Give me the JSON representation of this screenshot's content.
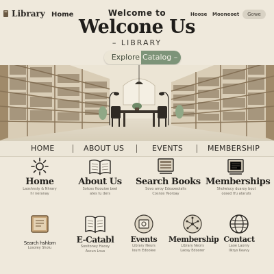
{
  "header": {
    "logo_text": "Library",
    "nav_home": "Home",
    "nav_right": [
      "Hoose",
      "Mooneoet"
    ],
    "nav_pill": "Gowe"
  },
  "hero": {
    "title_small": "Welcome to",
    "title_big": "Welcone Us",
    "title_sub": "– LIBRARY",
    "cta_left": "Explore",
    "cta_right": "Catalog –"
  },
  "nav": {
    "items": [
      "HOME",
      "ABOUT US",
      "EVENTS",
      "MEMBERSHIP"
    ]
  },
  "features_top": [
    {
      "title": "Home",
      "desc": [
        "Laoshnsty & Nhrary",
        "hr neranay"
      ],
      "icon": "sun-icon"
    },
    {
      "title": "About Us",
      "desc": [
        "Sotoss ftoouioe beel",
        "ates tu ders"
      ],
      "icon": "open-book-icon"
    },
    {
      "title": "Search Books",
      "desc": [
        "Sovo arroy Edoaxeolalis",
        "Cosnos Yeoroay"
      ],
      "icon": "book-stack-icon"
    },
    {
      "title": "Memberships",
      "desc": [
        "Sholwiucy duaroy bout",
        "oosed tfu ataruts"
      ],
      "icon": "open-book-icon"
    }
  ],
  "features_bottom": [
    {
      "title": "Search hshlorn",
      "desc": [
        "Losoiey Sholu"
      ],
      "icon": "book-icon"
    },
    {
      "title": "E-Catabl",
      "desc": [
        "Sonitoney Hacey",
        "Ascun Lnus"
      ],
      "icon": "ebook-icon"
    },
    {
      "title": "Events",
      "desc": [
        "Library Neurs",
        "lourn Edoolee"
      ],
      "icon": "event-icon"
    },
    {
      "title": "Membership",
      "desc": [
        "Library Neors",
        "Laosy Edoorer"
      ],
      "icon": "network-icon"
    },
    {
      "title": "Contact",
      "desc": [
        "Laoe Laoniy",
        "Ilkrys Keavy"
      ],
      "icon": "globe-icon"
    }
  ],
  "colors": {
    "background": "#efe9dc",
    "accent_green": "#7d9479",
    "text_dark": "#24221e"
  }
}
